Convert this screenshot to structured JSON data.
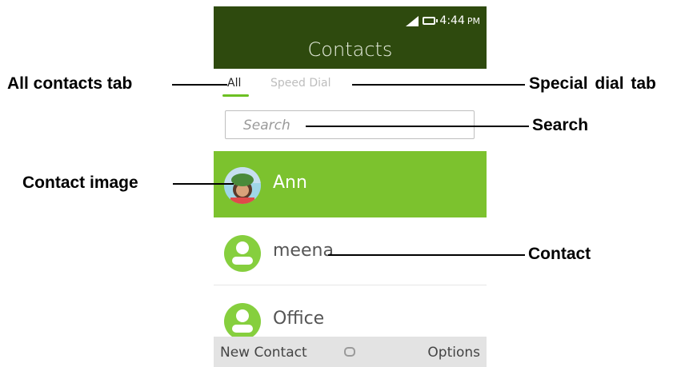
{
  "status_bar": {
    "time": "4:44",
    "ampm": "PM"
  },
  "header": {
    "title": "Contacts"
  },
  "tabs": [
    {
      "label": "All",
      "selected": true
    },
    {
      "label": "Speed Dial",
      "selected": false
    }
  ],
  "search": {
    "placeholder": "Search"
  },
  "contacts": [
    {
      "name": "Ann",
      "has_photo": true,
      "selected": true
    },
    {
      "name": "meena",
      "has_photo": false,
      "selected": false
    },
    {
      "name": "Office",
      "has_photo": false,
      "selected": false
    }
  ],
  "softkeys": {
    "left": "New Contact",
    "right": "Options"
  },
  "annotations": {
    "all_contacts_tab": "All contacts tab",
    "special_dial_tab": "Special  dial tab",
    "search": "Search",
    "contact_image": "Contact image",
    "contact": "Contact"
  },
  "colors": {
    "header_bg": "#2e4a0e",
    "selected_row": "#7cc22e",
    "tab_indicator": "#6cc022",
    "avatar_green": "#86cf3e"
  }
}
